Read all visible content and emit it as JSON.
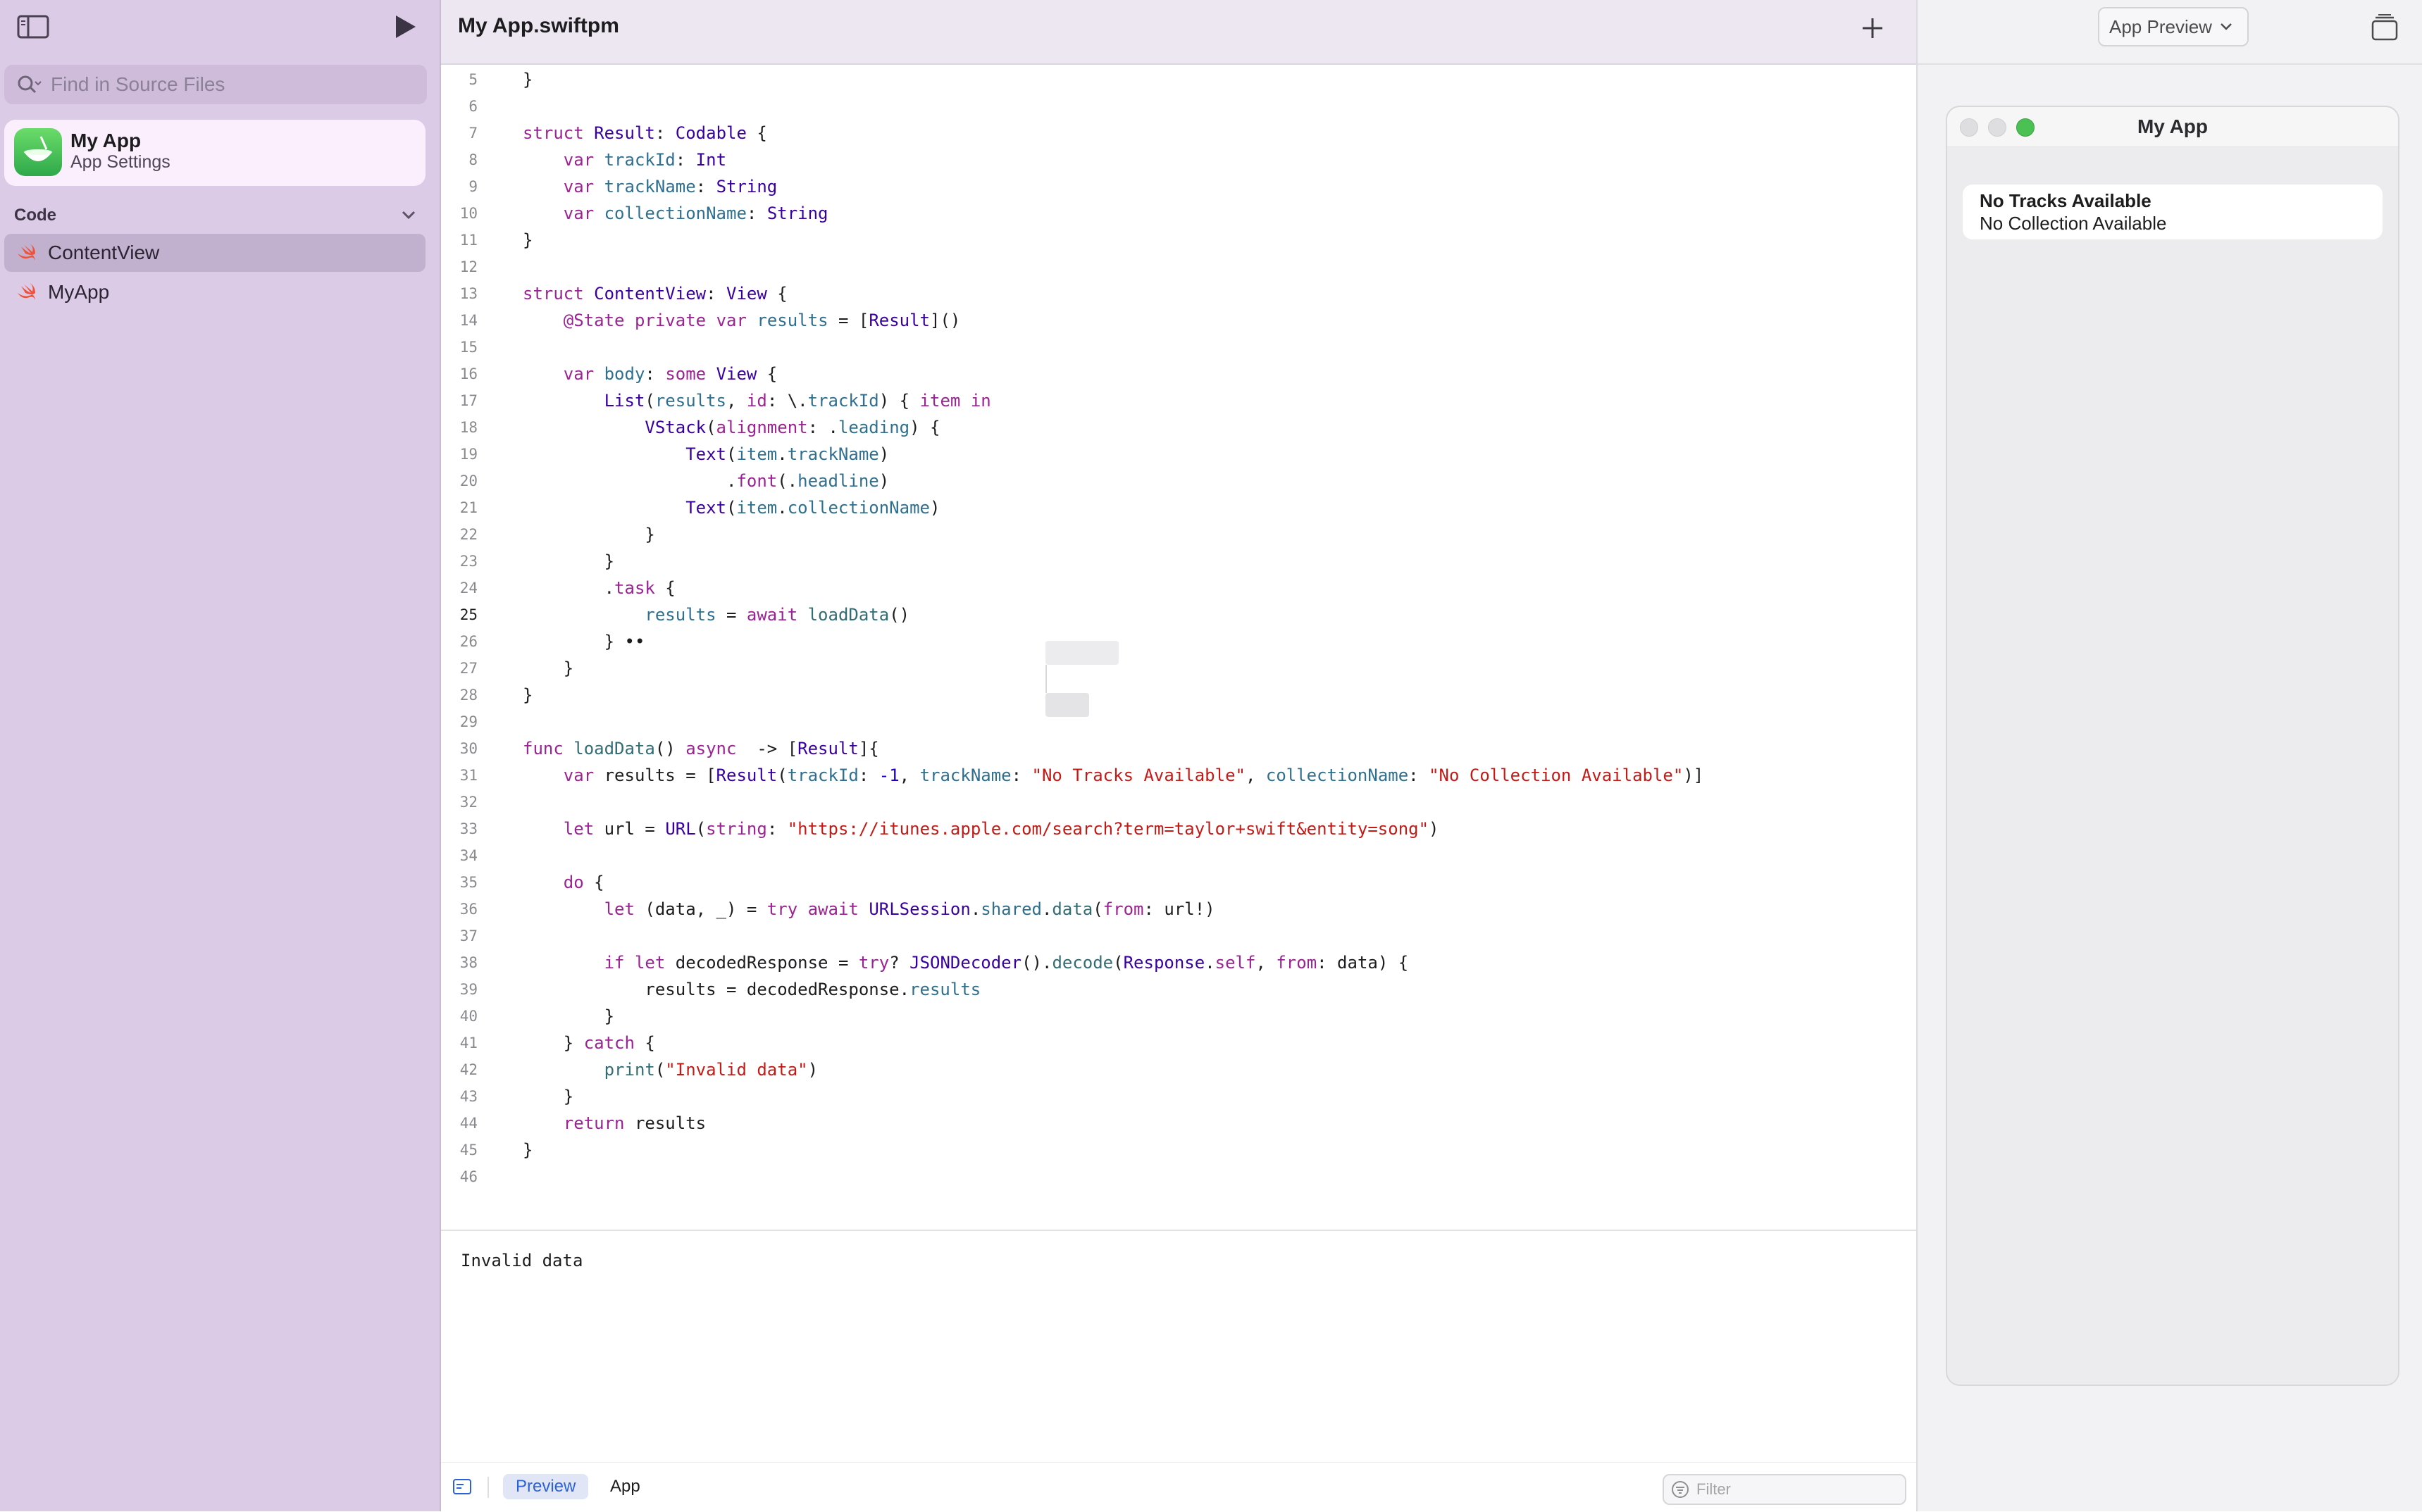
{
  "sidebar": {
    "search_placeholder": "Find in Source Files",
    "app": {
      "title": "My App",
      "subtitle": "App Settings"
    },
    "section_label": "Code",
    "items": [
      {
        "label": "ContentView",
        "selected": true
      },
      {
        "label": "MyApp",
        "selected": false
      }
    ]
  },
  "editor": {
    "title": "My App.swiftpm",
    "current_line": 25,
    "lines": [
      {
        "n": "5",
        "html": "}"
      },
      {
        "n": "6",
        "html": ""
      },
      {
        "n": "7",
        "html": "<span class=\"kw\">struct</span> <span class=\"ty\">Result</span>: <span class=\"ty\">Codable</span> {"
      },
      {
        "n": "8",
        "html": "    <span class=\"kw\">var</span> <span class=\"pr\">trackId</span>: <span class=\"ty\">Int</span>"
      },
      {
        "n": "9",
        "html": "    <span class=\"kw\">var</span> <span class=\"pr\">trackName</span>: <span class=\"ty\">String</span>"
      },
      {
        "n": "10",
        "html": "    <span class=\"kw\">var</span> <span class=\"pr\">collectionName</span>: <span class=\"ty\">String</span>"
      },
      {
        "n": "11",
        "html": "}"
      },
      {
        "n": "12",
        "html": ""
      },
      {
        "n": "13",
        "html": "<span class=\"kw\">struct</span> <span class=\"ty\">ContentView</span>: <span class=\"ty\">View</span> {"
      },
      {
        "n": "14",
        "html": "    <span class=\"kw\">@State</span> <span class=\"kw\">private</span> <span class=\"kw\">var</span> <span class=\"pr\">results</span> = [<span class=\"ty\">Result</span>]()"
      },
      {
        "n": "15",
        "html": ""
      },
      {
        "n": "16",
        "html": "    <span class=\"kw\">var</span> <span class=\"pr\">body</span>: <span class=\"kw\">some</span> <span class=\"ty\">View</span> {"
      },
      {
        "n": "17",
        "html": "        <span class=\"ty\">List</span>(<span class=\"pr\">results</span>, <span class=\"kw\">id</span>: \\.<span class=\"pr\">trackId</span>) { <span class=\"kw\">item</span> <span class=\"kw\">in</span>"
      },
      {
        "n": "18",
        "html": "            <span class=\"ty\">VStack</span>(<span class=\"kw\">alignment</span>: .<span class=\"pr\">leading</span>) {"
      },
      {
        "n": "19",
        "html": "                <span class=\"ty\">Text</span>(<span class=\"pr\">item</span>.<span class=\"pr\">trackName</span>)"
      },
      {
        "n": "20",
        "html": "                    .<span class=\"kw\">font</span>(.<span class=\"pr\">headline</span>)"
      },
      {
        "n": "21",
        "html": "                <span class=\"ty\">Text</span>(<span class=\"pr\">item</span>.<span class=\"pr\">collectionName</span>)"
      },
      {
        "n": "22",
        "html": "            }"
      },
      {
        "n": "23",
        "html": "        }"
      },
      {
        "n": "24",
        "html": "        .<span class=\"kw\">task</span> {"
      },
      {
        "n": "25",
        "html": "            <span class=\"pr\">results</span> = <span class=\"kw\">await</span> <span class=\"fn\">loadData</span>()"
      },
      {
        "n": "26",
        "html": "        } ••"
      },
      {
        "n": "27",
        "html": "    }"
      },
      {
        "n": "28",
        "html": "}"
      },
      {
        "n": "29",
        "html": ""
      },
      {
        "n": "30",
        "html": "<span class=\"kw\">func</span> <span class=\"fn\">loadData</span>() <span class=\"kw\">async</span>  -&gt; [<span class=\"ty\">Result</span>]{"
      },
      {
        "n": "31",
        "html": "    <span class=\"kw\">var</span> results = [<span class=\"ty\">Result</span>(<span class=\"pr\">trackId</span>: <span class=\"nm\">-1</span>, <span class=\"pr\">trackName</span>: <span class=\"st\">\"No Tracks Available\"</span>, <span class=\"pr\">collectionName</span>: <span class=\"st\">\"No Collection Available\"</span>)]"
      },
      {
        "n": "32",
        "html": ""
      },
      {
        "n": "33",
        "html": "    <span class=\"kw\">let</span> url = <span class=\"ty\">URL</span>(<span class=\"kw\">string</span>: <span class=\"st\">\"https://itunes.apple.com/search?term=taylor+swift&amp;entity=song\"</span>)"
      },
      {
        "n": "34",
        "html": ""
      },
      {
        "n": "35",
        "html": "    <span class=\"kw\">do</span> {"
      },
      {
        "n": "36",
        "html": "        <span class=\"kw\">let</span> (data, _) = <span class=\"kw\">try</span> <span class=\"kw\">await</span> <span class=\"ty\">URLSession</span>.<span class=\"pr\">shared</span>.<span class=\"fn\">data</span>(<span class=\"kw\">from</span>: url!)"
      },
      {
        "n": "37",
        "html": ""
      },
      {
        "n": "38",
        "html": "        <span class=\"kw\">if</span> <span class=\"kw\">let</span> decodedResponse = <span class=\"kw\">try</span>? <span class=\"ty\">JSONDecoder</span>().<span class=\"fn\">decode</span>(<span class=\"ty\">Response</span>.<span class=\"kw\">self</span>, <span class=\"kw\">from</span>: data) {"
      },
      {
        "n": "39",
        "html": "            results = decodedResponse.<span class=\"pr\">results</span>"
      },
      {
        "n": "40",
        "html": "        }"
      },
      {
        "n": "41",
        "html": "    } <span class=\"kw\">catch</span> {"
      },
      {
        "n": "42",
        "html": "        <span class=\"fn\">print</span>(<span class=\"st\">\"Invalid data\"</span>)"
      },
      {
        "n": "43",
        "html": "    }"
      },
      {
        "n": "44",
        "html": "    <span class=\"kw\">return</span> results"
      },
      {
        "n": "45",
        "html": "}"
      },
      {
        "n": "46",
        "html": ""
      }
    ]
  },
  "console": {
    "output": "Invalid data"
  },
  "bottom_bar": {
    "tab_preview": "Preview",
    "tab_app": "App",
    "filter_placeholder": "Filter"
  },
  "preview": {
    "dropdown_label": "App Preview",
    "window_title": "My App",
    "row_title": "No Tracks Available",
    "row_subtitle": "No Collection Available"
  },
  "colors": {
    "sidebar_bg": "#dccbe6",
    "keyword": "#9b2393",
    "type": "#3900a0",
    "string": "#c41a16",
    "accent": "#2b62d6"
  },
  "icons": [
    "sidebar-toggle-icon",
    "play-icon",
    "search-icon",
    "app-icon",
    "chevron-down-icon",
    "swift-file-icon",
    "plus-icon",
    "console-toggle-icon",
    "filter-icon",
    "window-stack-icon"
  ]
}
